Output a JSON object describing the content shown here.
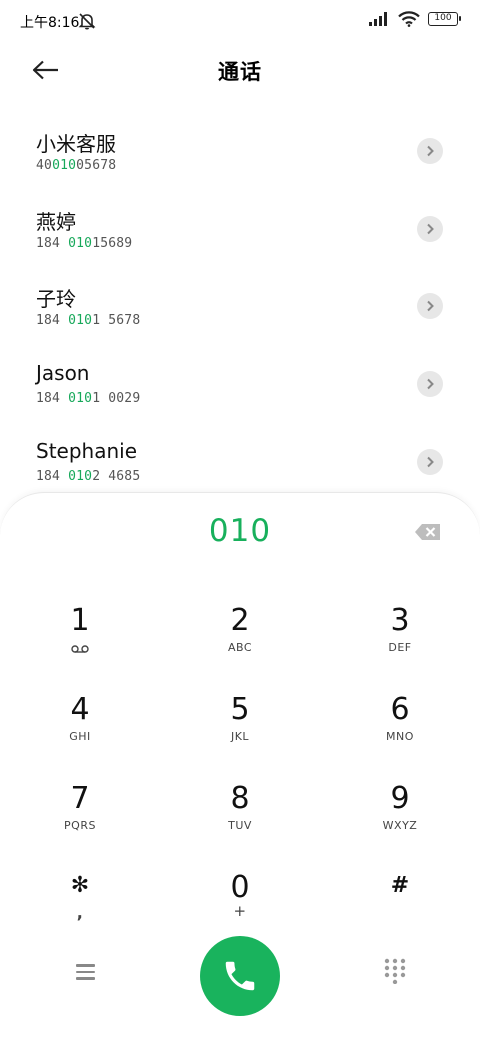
{
  "status_bar": {
    "time": "上午8:16",
    "battery": "100"
  },
  "header": {
    "title": "通话"
  },
  "contacts": [
    {
      "name": "小米客服",
      "number_pre": "40",
      "number_match": "010",
      "number_post": "05678"
    },
    {
      "name": "燕婷",
      "number_pre": "184 ",
      "number_match": "010",
      "number_post": "15689"
    },
    {
      "name": "子玲",
      "number_pre": "184 ",
      "number_match": "010",
      "number_post": "1 5678"
    },
    {
      "name": "Jason",
      "number_pre": "184 ",
      "number_match": "010",
      "number_post": "1 0029"
    },
    {
      "name": "Stephanie",
      "number_pre": "184 ",
      "number_match": "010",
      "number_post": "2 4685"
    }
  ],
  "dialer": {
    "input": "010",
    "keys": [
      {
        "digit": "1",
        "letters": ""
      },
      {
        "digit": "2",
        "letters": "ABC"
      },
      {
        "digit": "3",
        "letters": "DEF"
      },
      {
        "digit": "4",
        "letters": "GHI"
      },
      {
        "digit": "5",
        "letters": "JKL"
      },
      {
        "digit": "6",
        "letters": "MNO"
      },
      {
        "digit": "7",
        "letters": "PQRS"
      },
      {
        "digit": "8",
        "letters": "TUV"
      },
      {
        "digit": "9",
        "letters": "WXYZ"
      },
      {
        "digit": "✻",
        "letters": ","
      },
      {
        "digit": "0",
        "letters": "+"
      },
      {
        "digit": "#",
        "letters": ""
      }
    ]
  },
  "icons": {
    "mute": "bell-off-icon",
    "signal": "signal-icon",
    "wifi": "wifi-icon",
    "back": "arrow-left-icon",
    "chevron": "chevron-right-icon",
    "backspace": "backspace-icon",
    "voicemail": "voicemail-icon",
    "menu": "menu-icon",
    "call": "phone-icon",
    "keypad": "dialpad-icon"
  },
  "colors": {
    "accent": "#19b35d",
    "highlight": "#17a85a"
  }
}
